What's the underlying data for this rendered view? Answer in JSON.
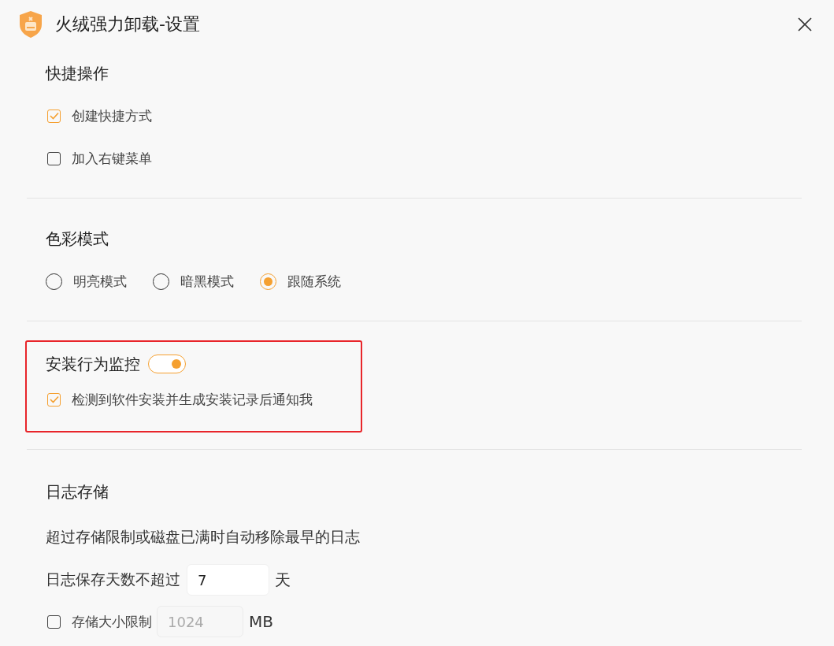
{
  "window": {
    "title": "火绒强力卸载-设置"
  },
  "sections": [
    {
      "kind": "checks",
      "heading": "快捷操作",
      "options": [
        {
          "label": "创建快捷方式",
          "checked": true
        },
        {
          "label": "加入右键菜单",
          "checked": false
        }
      ]
    },
    {
      "kind": "radios",
      "heading": "色彩模式",
      "options": [
        {
          "label": "明亮模式",
          "selected": false
        },
        {
          "label": "暗黑模式",
          "selected": false
        },
        {
          "label": "跟随系统",
          "selected": true
        }
      ]
    },
    {
      "kind": "monitor",
      "heading": "安装行为监控",
      "on": true,
      "highlighted": true,
      "options": [
        {
          "label": "检测到软件安装并生成安装记录后通知我",
          "checked": true
        }
      ]
    },
    {
      "kind": "log",
      "heading": "日志存储",
      "description": "超过存储限制或磁盘已满时自动移除最早的日志",
      "days": {
        "label": "日志保存天数不超过",
        "value": "7",
        "unit": "天"
      },
      "size": {
        "label": "存储大小限制",
        "checked": false,
        "value": "1024",
        "disabled": true,
        "unit": "MB"
      }
    }
  ]
}
